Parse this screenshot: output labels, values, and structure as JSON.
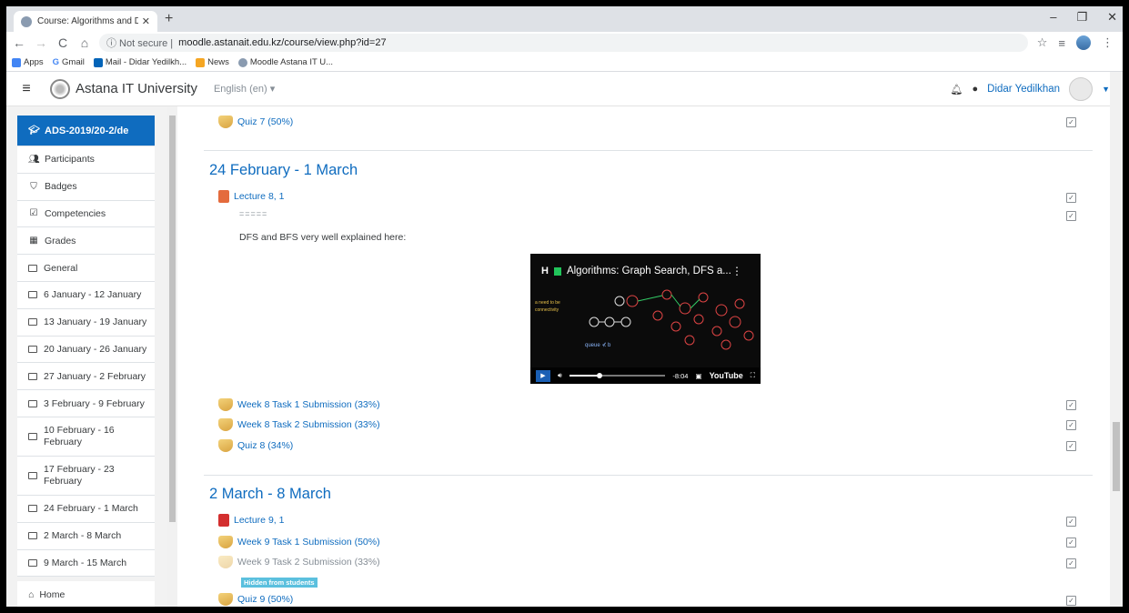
{
  "browser": {
    "tab_title": "Course: Algorithms and Data Str...",
    "new_tab": "+",
    "window_controls": [
      "–",
      "❐",
      "✕"
    ],
    "not_secure": "ⓘ Not secure  |",
    "url": "moodle.astanait.edu.kz/course/view.php?id=27",
    "bookmarks": [
      "Apps",
      "Gmail",
      "Mail - Didar Yedilkh...",
      "News",
      "Moodle Astana IT U..."
    ]
  },
  "navbar": {
    "site_name": "Astana IT University",
    "language": "English (en) ▾",
    "user_name": "Didar Yedilkhan"
  },
  "sidebar": {
    "course": "ADS-2019/20-2/de",
    "items": [
      {
        "label": "Participants",
        "icon": "users-icon"
      },
      {
        "label": "Badges",
        "icon": "shield-icon"
      },
      {
        "label": "Competencies",
        "icon": "checkbox-icon"
      },
      {
        "label": "Grades",
        "icon": "table-icon"
      }
    ],
    "sections": [
      "General",
      "6 January - 12 January",
      "13 January - 19 January",
      "20 January - 26 January",
      "27 January - 2 February",
      "3 February - 9 February",
      "10 February - 16 February",
      "17 February - 23 February",
      "24 February - 1 March",
      "2 March - 8 March",
      "9 March - 15 March"
    ],
    "home": "Home"
  },
  "main": {
    "quiz7": "Quiz 7 (50%)",
    "section1": {
      "title": "24 February - 1 March",
      "lecture": "Lecture 8, 1",
      "separator": "=====",
      "text": "DFS and BFS very well explained here:",
      "video": {
        "title": "Algorithms: Graph Search, DFS a...",
        "brand": "H",
        "time": "-8:04",
        "logo": "YouTube"
      },
      "task1": "Week 8 Task 1 Submission (33%)",
      "task2": "Week 8 Task 2 Submission (33%)",
      "quiz": "Quiz 8 (34%)"
    },
    "section2": {
      "title": "2 March - 8 March",
      "lecture": "Lecture 9, 1",
      "task1": "Week 9 Task 1 Submission (50%)",
      "task2": "Week 9 Task 2 Submission (33%)",
      "hidden_badge": "Hidden from students",
      "quiz": "Quiz 9 (50%)"
    }
  }
}
